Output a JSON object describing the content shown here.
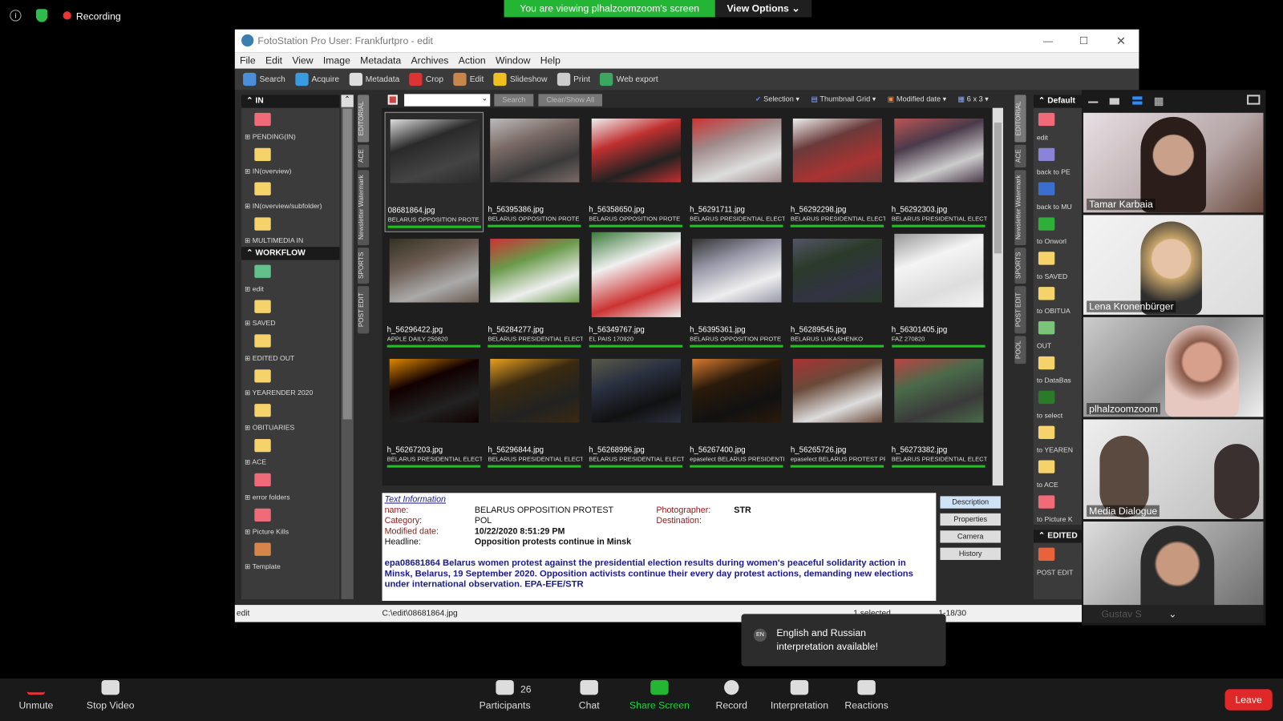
{
  "zoom": {
    "info_icon": "info-icon",
    "recording": "Recording",
    "banner": "You are viewing plhalzoomzoom's screen",
    "view_options": "View Options",
    "toolbar": [
      {
        "label": "Unmute",
        "icon": "mic-muted-icon"
      },
      {
        "label": "Stop Video",
        "icon": "video-icon"
      },
      {
        "label": "Participants",
        "icon": "participants-icon",
        "count": "26"
      },
      {
        "label": "Chat",
        "icon": "chat-icon"
      },
      {
        "label": "Share Screen",
        "icon": "share-screen-icon"
      },
      {
        "label": "Record",
        "icon": "record-icon"
      },
      {
        "label": "Interpretation",
        "icon": "globe-icon"
      },
      {
        "label": "Reactions",
        "icon": "reactions-icon"
      }
    ],
    "leave": "Leave",
    "toast": {
      "badge": "EN",
      "text": "English and Russian interpretation available!"
    },
    "participants": [
      "Tamar Karbaia",
      "Lena Kronenbürger",
      "plhalzoomzoom",
      "Media Dialogue",
      "Gustav S"
    ]
  },
  "app": {
    "title": "FotoStation Pro  User: Frankfurtpro - edit",
    "menu": [
      "File",
      "Edit",
      "View",
      "Image",
      "Metadata",
      "Archives",
      "Action",
      "Window",
      "Help"
    ],
    "toolbar": [
      "Search",
      "Acquire",
      "Metadata",
      "Crop",
      "Edit",
      "Slideshow",
      "Print",
      "Web export"
    ],
    "filter": {
      "search": "Search",
      "clear": "Clear/Show All"
    },
    "view": {
      "selection": "Selection",
      "layout": "Thumbnail Grid",
      "sort": "Modified date",
      "grid": "6 x 3"
    },
    "left": {
      "sections": [
        {
          "title": "IN",
          "items": [
            "PENDING(IN)",
            "IN(overview)",
            "IN(overview/subfolder)",
            "MULTIMEDIA IN"
          ]
        },
        {
          "title": "WORKFLOW",
          "items": [
            "edit",
            "SAVED",
            "EDITED OUT",
            "YEARENDER 2020",
            "OBITUARIES",
            "ACE",
            "error folders",
            "Picture Kills",
            "Template"
          ]
        }
      ]
    },
    "vtabs_left": [
      "EDITORIAL",
      "ACE",
      "Newsletter Watermark",
      "SPORTS",
      "POST EDIT"
    ],
    "vtabs_right": [
      "EDITORIAL",
      "ACE",
      "Newsletter Watermark",
      "SPORTS",
      "POST EDIT",
      "POOL"
    ],
    "right": {
      "default_title": "Default",
      "items": [
        "edit",
        "back to PE",
        "back to MU",
        "to Onworl",
        "to SAVED",
        "to OBITUA",
        "OUT",
        "to DataBas",
        "to select",
        "to YEAREN",
        "to ACE",
        "to Picture K"
      ],
      "edited_title": "EDITED",
      "edited_items": [
        "POST EDIT"
      ]
    },
    "thumbs": [
      {
        "file": "08681864.jpg",
        "caption": "BELARUS OPPOSITION PROTE"
      },
      {
        "file": "h_56395386.jpg",
        "caption": "BELARUS OPPOSITION PROTE"
      },
      {
        "file": "h_56358650.jpg",
        "caption": "BELARUS OPPOSITION PROTE"
      },
      {
        "file": "h_56291711.jpg",
        "caption": "BELARUS PRESIDENTIAL ELECT"
      },
      {
        "file": "h_56292298.jpg",
        "caption": "BELARUS PRESIDENTIAL ELECT"
      },
      {
        "file": "h_56292303.jpg",
        "caption": "BELARUS PRESIDENTIAL ELECT"
      },
      {
        "file": "h_56296422.jpg",
        "caption": "APPLE DAILY 250820"
      },
      {
        "file": "h_56284277.jpg",
        "caption": "BELARUS PRESIDENTIAL ELECT"
      },
      {
        "file": "h_56349767.jpg",
        "caption": "EL PAIS 170920"
      },
      {
        "file": "h_56395361.jpg",
        "caption": "BELARUS OPPOSITION PROTE"
      },
      {
        "file": "h_56289545.jpg",
        "caption": "BELARUS LUKASHENKO"
      },
      {
        "file": "h_56301405.jpg",
        "caption": "FAZ 270820"
      },
      {
        "file": "h_56267203.jpg",
        "caption": "BELARUS PRESIDENTIAL ELECT"
      },
      {
        "file": "h_56296844.jpg",
        "caption": "BELARUS PRESIDENTIAL ELECT"
      },
      {
        "file": "h_56268996.jpg",
        "caption": "BELARUS PRESIDENTIAL ELECT"
      },
      {
        "file": "h_56267400.jpg",
        "caption": "epaselect BELARUS PRESIDENTI"
      },
      {
        "file": "h_56265726.jpg",
        "caption": "epaselect BELARUS PROTEST PR"
      },
      {
        "file": "h_56273382.jpg",
        "caption": "BELARUS PRESIDENTIAL ELECT"
      }
    ],
    "info": {
      "heading": "Text Information",
      "name_label": "name:",
      "name": "BELARUS OPPOSITION PROTEST",
      "category_label": "Category:",
      "category": "POL",
      "modified_label": "Modified date:",
      "modified": "10/22/2020 8:51:29 PM",
      "headline_label": "Headline:",
      "headline": "Opposition protests continue in Minsk",
      "photographer_label": "Photographer:",
      "photographer": "STR",
      "destination_label": "Destination:",
      "caption": "epa08681864 Belarus women protest against the presidential election results during women's peaceful solidarity action in Minsk, Belarus, 19 September 2020. Opposition activists continue their every day protest actions, demanding new elections under international observation.  EPA-EFE/STR",
      "buttons": [
        "Description",
        "Properties",
        "Camera",
        "History"
      ]
    },
    "status": {
      "folder": "edit",
      "path": "C:\\edit\\08681864.jpg",
      "selected": "1 selected",
      "count": "1-18/30"
    }
  }
}
